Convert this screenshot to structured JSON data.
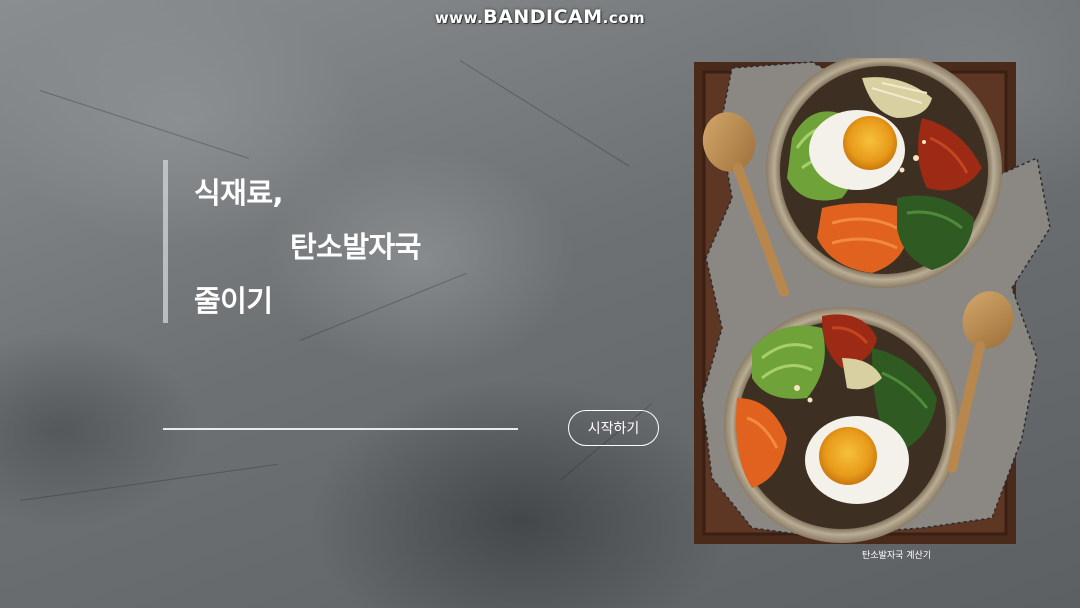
{
  "watermark": {
    "prefix": "www.",
    "brand": "BANDICAM",
    "suffix": ".com"
  },
  "hero": {
    "title_line1": "식재료,",
    "title_line2": "탄소발자국",
    "title_line3": "줄이기"
  },
  "actions": {
    "start_label": "시작하기"
  },
  "image": {
    "icon": "bibimbap-photo",
    "caption": "탄소발자국 계산기"
  },
  "colors": {
    "text": "#ffffff",
    "background": "#6d7173",
    "tray": "#5a3422"
  }
}
